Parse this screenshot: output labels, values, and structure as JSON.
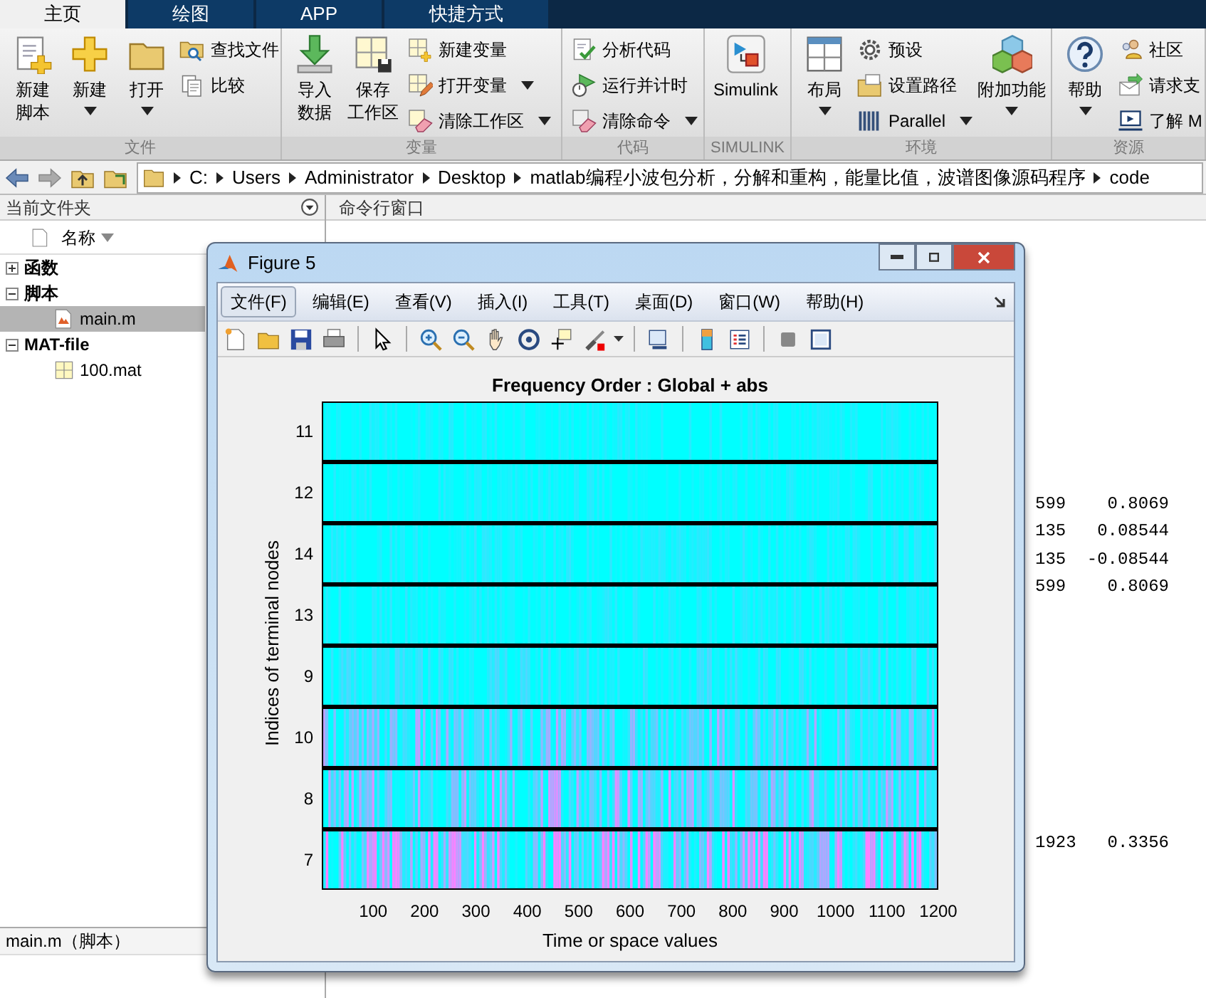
{
  "tabs": [
    {
      "label": "主页",
      "selected": true
    },
    {
      "label": "绘图",
      "selected": false
    },
    {
      "label": "APP",
      "selected": false
    },
    {
      "label": "快捷方式",
      "selected": false
    }
  ],
  "toolstrip": [
    {
      "label": "文件",
      "items": [
        {
          "kind": "large",
          "lines": [
            "新建",
            "脚本"
          ],
          "dropdown": false
        },
        {
          "kind": "large",
          "lines": [
            "新建"
          ],
          "dropdown": true
        },
        {
          "kind": "large",
          "lines": [
            "打开"
          ],
          "dropdown": true
        },
        {
          "kind": "column",
          "items": [
            {
              "label": "查找文件",
              "dropdown": false
            },
            {
              "label": "比较",
              "dropdown": false
            }
          ]
        }
      ]
    },
    {
      "label": "变量",
      "items": [
        {
          "kind": "large",
          "lines": [
            "导入",
            "数据"
          ],
          "dropdown": false
        },
        {
          "kind": "large",
          "lines": [
            "保存",
            "工作区"
          ],
          "dropdown": false
        },
        {
          "kind": "column",
          "items": [
            {
              "label": "新建变量",
              "dropdown": false
            },
            {
              "label": "打开变量",
              "dropdown": true
            },
            {
              "label": "清除工作区",
              "dropdown": true
            }
          ]
        }
      ]
    },
    {
      "label": "代码",
      "items": [
        {
          "kind": "column",
          "items": [
            {
              "label": "分析代码",
              "dropdown": false
            },
            {
              "label": "运行并计时",
              "dropdown": false
            },
            {
              "label": "清除命令",
              "dropdown": true
            }
          ]
        }
      ]
    },
    {
      "label": "SIMULINK",
      "items": [
        {
          "kind": "large",
          "lines": [
            "Simulink"
          ],
          "dropdown": false
        }
      ]
    },
    {
      "label": "环境",
      "items": [
        {
          "kind": "large",
          "lines": [
            "布局"
          ],
          "dropdown": true
        },
        {
          "kind": "column",
          "items": [
            {
              "label": "预设",
              "dropdown": false
            },
            {
              "label": "设置路径",
              "dropdown": false
            },
            {
              "label": "Parallel",
              "dropdown": true
            }
          ]
        },
        {
          "kind": "large",
          "lines": [
            "附加功能"
          ],
          "dropdown": true
        }
      ]
    },
    {
      "label": "资源",
      "items": [
        {
          "kind": "large",
          "lines": [
            "帮助"
          ],
          "dropdown": true
        },
        {
          "kind": "column",
          "items": [
            {
              "label": "社区",
              "dropdown": false
            },
            {
              "label": "请求支",
              "dropdown": false
            },
            {
              "label": "了解 M",
              "dropdown": false
            }
          ]
        }
      ]
    }
  ],
  "address_bar": {
    "segments": [
      "C:",
      "Users",
      "Administrator",
      "Desktop",
      "matlab编程小波包分析，分解和重构，能量比值，波谱图像源码程序",
      "code"
    ]
  },
  "file_browser": {
    "title": "当前文件夹",
    "column": "名称",
    "tree": [
      {
        "label": "函数",
        "expanded": false,
        "selected": false
      },
      {
        "label": "脚本",
        "expanded": true,
        "selected": false,
        "children": [
          {
            "label": "main.m",
            "selected": true
          }
        ]
      },
      {
        "label": "MAT-file",
        "expanded": true,
        "selected": false,
        "children": [
          {
            "label": "100.mat",
            "selected": false
          }
        ]
      }
    ],
    "details": "main.m（脚本）"
  },
  "command_window": {
    "title": "命令行窗口",
    "output_blocks": [
      [
        [
          "599",
          "0.8069"
        ],
        [
          "135",
          "0.08544"
        ],
        [
          "135",
          "-0.08544"
        ],
        [
          "599",
          "0.8069"
        ]
      ],
      [
        [
          "1923",
          "0.3356"
        ]
      ]
    ]
  },
  "figure": {
    "title": "Figure 5",
    "menus": [
      {
        "label": "文件(F)",
        "selected": true
      },
      {
        "label": "编辑(E)",
        "selected": false
      },
      {
        "label": "查看(V)",
        "selected": false
      },
      {
        "label": "插入(I)",
        "selected": false
      },
      {
        "label": "工具(T)",
        "selected": false
      },
      {
        "label": "桌面(D)",
        "selected": false
      },
      {
        "label": "窗口(W)",
        "selected": false
      },
      {
        "label": "帮助(H)",
        "selected": false
      }
    ],
    "plot": {
      "title": "Frequency Order : Global + abs",
      "xlabel": "Time or space values",
      "ylabel": "Indices of terminal nodes",
      "y_tick_labels": [
        "11",
        "12",
        "14",
        "13",
        "9",
        "10",
        "8",
        "7"
      ],
      "x_tick_labels": [
        "100",
        "200",
        "300",
        "400",
        "500",
        "600",
        "700",
        "800",
        "900",
        "1000",
        "1100",
        "1200"
      ]
    }
  }
}
